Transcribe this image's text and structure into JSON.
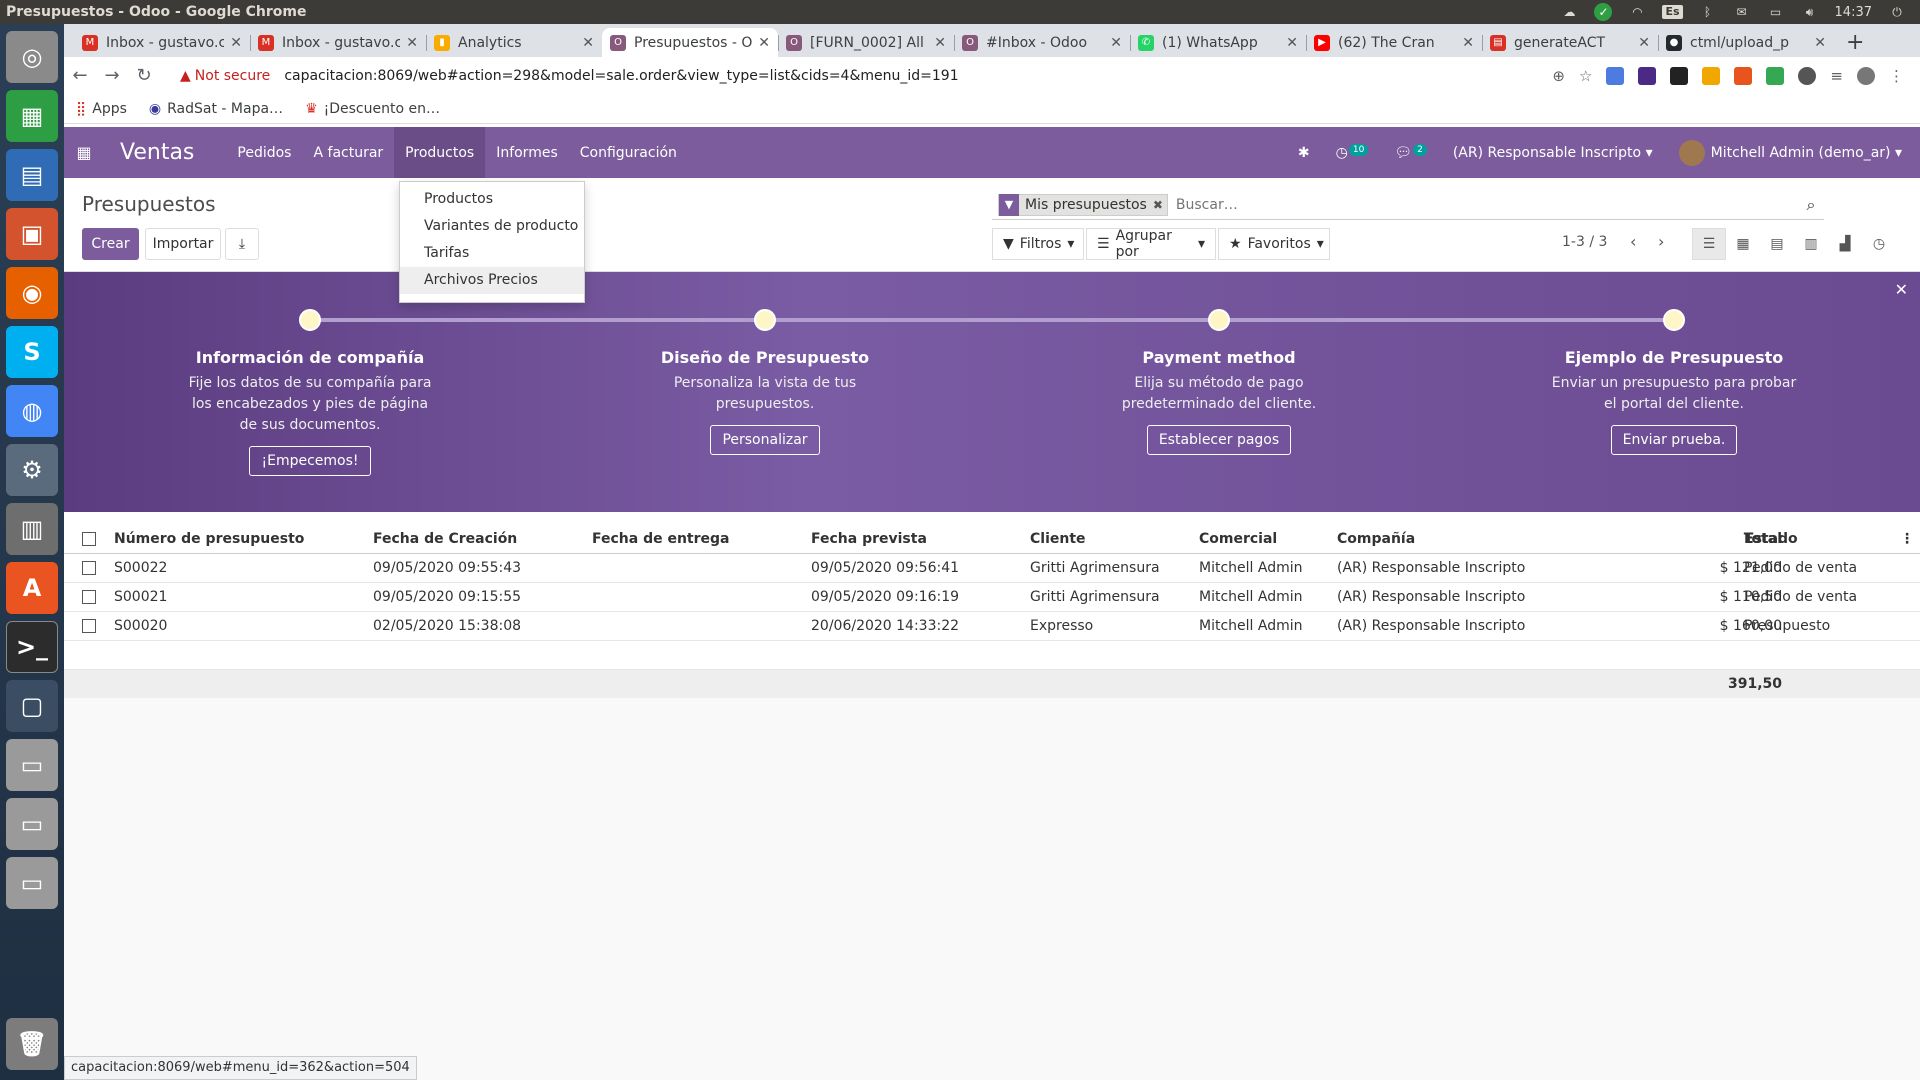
{
  "window": {
    "title": "Presupuestos - Odoo - Google Chrome",
    "clock": "14:37",
    "lang": "Es"
  },
  "tabs": [
    {
      "label": "Inbox - gustavo.c",
      "color": "#d93025",
      "glyph": "M"
    },
    {
      "label": "Inbox - gustavo.c",
      "color": "#d93025",
      "glyph": "M"
    },
    {
      "label": "Analytics",
      "color": "#f9ab00",
      "glyph": "▮"
    },
    {
      "label": "Presupuestos - O",
      "color": "#875a7b",
      "glyph": "O",
      "active": true
    },
    {
      "label": "[FURN_0002] All",
      "color": "#875a7b",
      "glyph": "O"
    },
    {
      "label": "#Inbox - Odoo",
      "color": "#875a7b",
      "glyph": "O"
    },
    {
      "label": "(1) WhatsApp",
      "color": "#25d366",
      "glyph": "✆"
    },
    {
      "label": "(62) The Cran",
      "color": "#ff0000",
      "glyph": "▶"
    },
    {
      "label": "generateACT",
      "color": "#d93025",
      "glyph": "▤"
    },
    {
      "label": "ctml/upload_p",
      "color": "#24292e",
      "glyph": "●"
    }
  ],
  "address": {
    "warning": "Not secure",
    "url": "capacitacion:8069/web#action=298&model=sale.order&view_type=list&cids=4&menu_id=191"
  },
  "bookmarks": [
    {
      "label": "Apps"
    },
    {
      "label": "RadSat - Mapa…"
    },
    {
      "label": "¡Descuento en…"
    }
  ],
  "odoo_nav": {
    "brand": "Ventas",
    "menus": [
      "Pedidos",
      "A facturar",
      "Productos",
      "Informes",
      "Configuración"
    ],
    "activity_count": "10",
    "message_count": "2",
    "company": "(AR) Responsable Inscripto",
    "user": "Mitchell Admin (demo_ar)"
  },
  "products_dropdown": [
    "Productos",
    "Variantes de producto",
    "Tarifas",
    "Archivos Precios"
  ],
  "control_panel": {
    "breadcrumb": "Presupuestos",
    "create_label": "Crear",
    "import_label": "Importar",
    "facet": "Mis presupuestos",
    "search_placeholder": "Buscar…",
    "filters_label": "Filtros",
    "groupby_label": "Agrupar por",
    "favorites_label": "Favoritos",
    "pager": "1-3 / 3"
  },
  "onboarding": [
    {
      "title": "Información de compañía",
      "text": [
        "Fije los datos de su compañía para",
        "los encabezados y pies de página",
        "de sus documentos."
      ],
      "button": "¡Empecemos!"
    },
    {
      "title": "Diseño de Presupuesto",
      "text": [
        "Personaliza la vista de tus",
        "presupuestos."
      ],
      "button": "Personalizar"
    },
    {
      "title": "Payment method",
      "text": [
        "Elija su método de pago",
        "predeterminado del cliente."
      ],
      "button": "Establecer pagos"
    },
    {
      "title": "Ejemplo de Presupuesto",
      "text": [
        "Enviar un presupuesto para probar",
        "el portal del cliente."
      ],
      "button": "Enviar prueba."
    }
  ],
  "table": {
    "headers": [
      "Número de presupuesto",
      "Fecha de Creación",
      "Fecha de entrega",
      "Fecha prevista",
      "Cliente",
      "Comercial",
      "Compañía",
      "Total",
      "Estado"
    ],
    "rows": [
      [
        "S00022",
        "09/05/2020 09:55:43",
        "",
        "09/05/2020 09:56:41",
        "Gritti Agrimensura",
        "Mitchell Admin",
        "(AR) Responsable Inscripto",
        "$ 121,00",
        "Pedido de venta"
      ],
      [
        "S00021",
        "09/05/2020 09:15:55",
        "",
        "09/05/2020 09:16:19",
        "Gritti Agrimensura",
        "Mitchell Admin",
        "(AR) Responsable Inscripto",
        "$ 110,50",
        "Pedido de venta"
      ],
      [
        "S00020",
        "02/05/2020 15:38:08",
        "",
        "20/06/2020 14:33:22",
        "Expresso",
        "Mitchell Admin",
        "(AR) Responsable Inscripto",
        "$ 160,00",
        "Presupuesto"
      ]
    ],
    "total": "391,50"
  },
  "statusbar": "capacitacion:8069/web#menu_id=362&action=504"
}
